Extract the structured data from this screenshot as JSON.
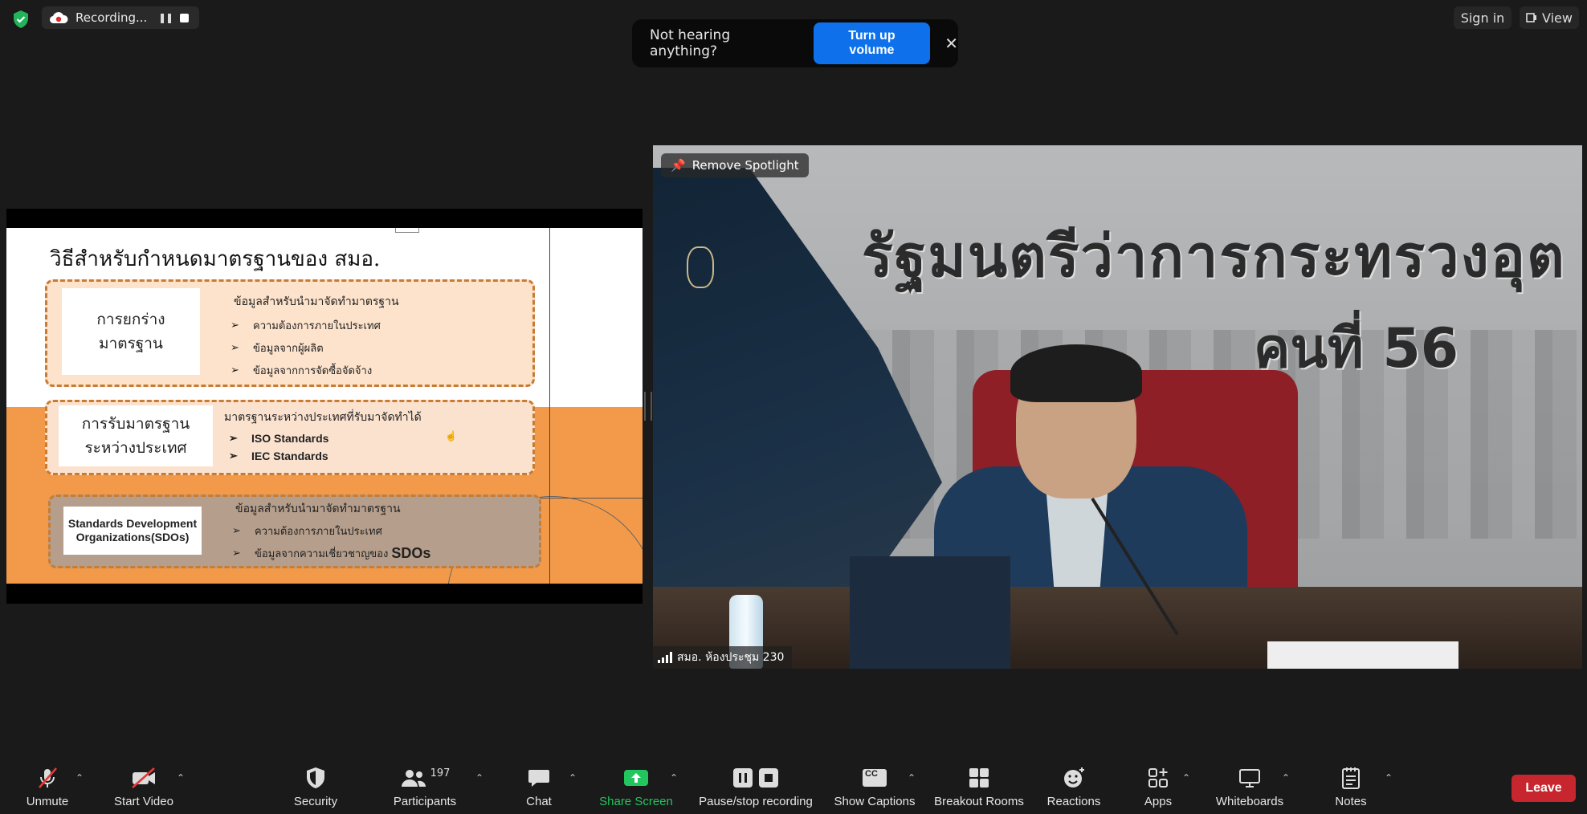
{
  "recording": {
    "label": "Recording..."
  },
  "toast": {
    "message": "Not hearing anything?",
    "action": "Turn up volume"
  },
  "top_right": {
    "signin": "Sign in",
    "view": "View"
  },
  "slide": {
    "title": "วิธีสำหรับกำหนดมาตรฐานของ สมอ.",
    "box1": {
      "label": "การยกร่าง\nมาตรฐาน",
      "heading": "ข้อมูลสำหรับนำมาจัดทำมาตรฐาน",
      "items": [
        "ความต้องการภายในประเทศ",
        "ข้อมูลจากผู้ผลิต",
        "ข้อมูลจากการจัดซื้อจัดจ้าง"
      ]
    },
    "box2": {
      "label": "การรับมาตรฐาน\nระหว่างประเทศ",
      "heading": "มาตรฐานระหว่างประเทศที่รับมาจัดทำได้",
      "items": [
        "ISO Standards",
        "IEC Standards"
      ]
    },
    "box3": {
      "label": "Standards Development Organizations(SDOs)",
      "heading": "ข้อมูลสำหรับนำมาจัดทำมาตรฐาน",
      "items": [
        "ความต้องการภายในประเทศ",
        "ข้อมูลจากความเชี่ยวชาญของ"
      ],
      "items_suffix": "SDOs"
    }
  },
  "video": {
    "spotlight_button": "Remove Spotlight",
    "participant_name": "สมอ. ห้องประชุม 230",
    "banner_line1": "รัฐมนตรีว่าการกระทรวงอุต",
    "banner_line2": "คนที่ 56"
  },
  "toolbar": {
    "unmute": "Unmute",
    "start_video": "Start Video",
    "security": "Security",
    "participants": "Participants",
    "participants_count": "197",
    "chat": "Chat",
    "share_screen": "Share Screen",
    "pause_recording": "Pause/stop recording",
    "captions": "Show Captions",
    "captions_badge": "CC",
    "breakout": "Breakout Rooms",
    "reactions": "Reactions",
    "apps": "Apps",
    "whiteboards": "Whiteboards",
    "notes": "Notes",
    "leave": "Leave"
  },
  "colors": {
    "accent_blue": "#0e71eb",
    "share_green": "#22c55e",
    "leave_red": "#c7262e",
    "slide_orange": "#f39a4a"
  }
}
